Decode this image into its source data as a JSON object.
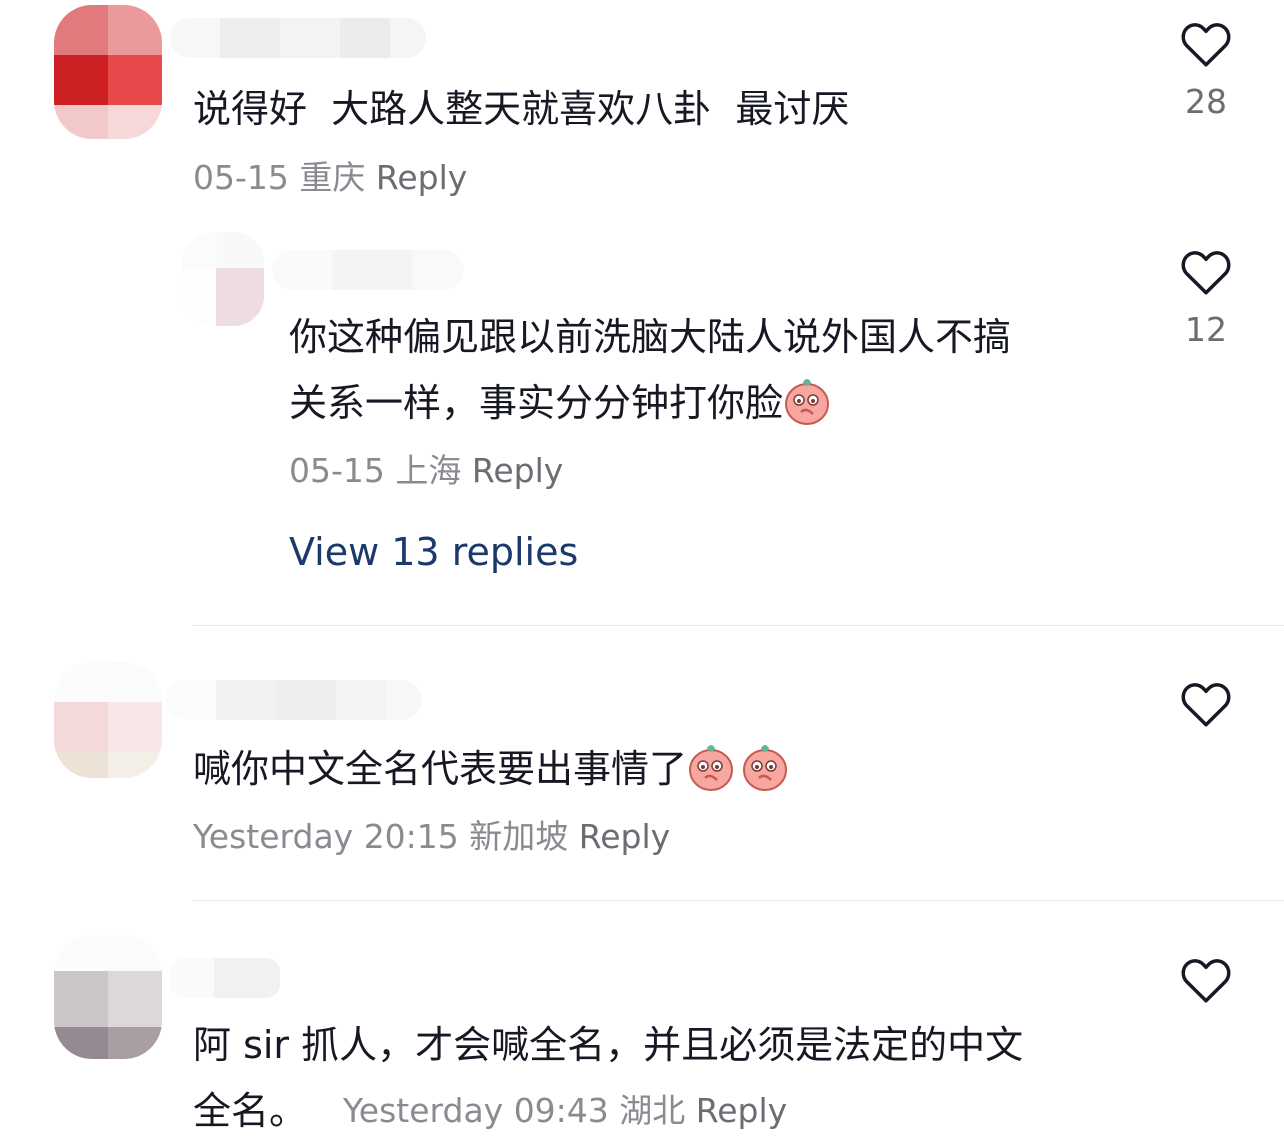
{
  "comments": [
    {
      "text": "说得好  大路人整天就喜欢八卦  最讨厌",
      "date": "05-15",
      "location": "重庆",
      "reply_label": "Reply",
      "likes": "28"
    },
    {
      "text_line1": "你这种偏见跟以前洗脑大陆人说外国人不搞",
      "text_line2": "关系一样，事实分分钟打你脸",
      "emoji": "shy-peach-emoji",
      "date": "05-15",
      "location": "上海",
      "reply_label": "Reply",
      "likes": "12",
      "view_replies": "View 13 replies"
    },
    {
      "text": "喊你中文全名代表要出事情了",
      "emoji": "shy-peach-emoji",
      "date": "Yesterday 20:15",
      "location": "新加坡",
      "reply_label": "Reply"
    },
    {
      "text_line1": "阿 sir 抓人，才会喊全名，并且必须是法定的中文",
      "text_line2": "全名。",
      "date": "Yesterday 09:43",
      "location": "湖北",
      "reply_label": "Reply"
    }
  ],
  "colors": {
    "text": "#161823",
    "meta": "#8a8b91",
    "link": "#1b3a6b",
    "heart": "#161823"
  },
  "icons": {
    "like": "heart-outline-icon"
  }
}
